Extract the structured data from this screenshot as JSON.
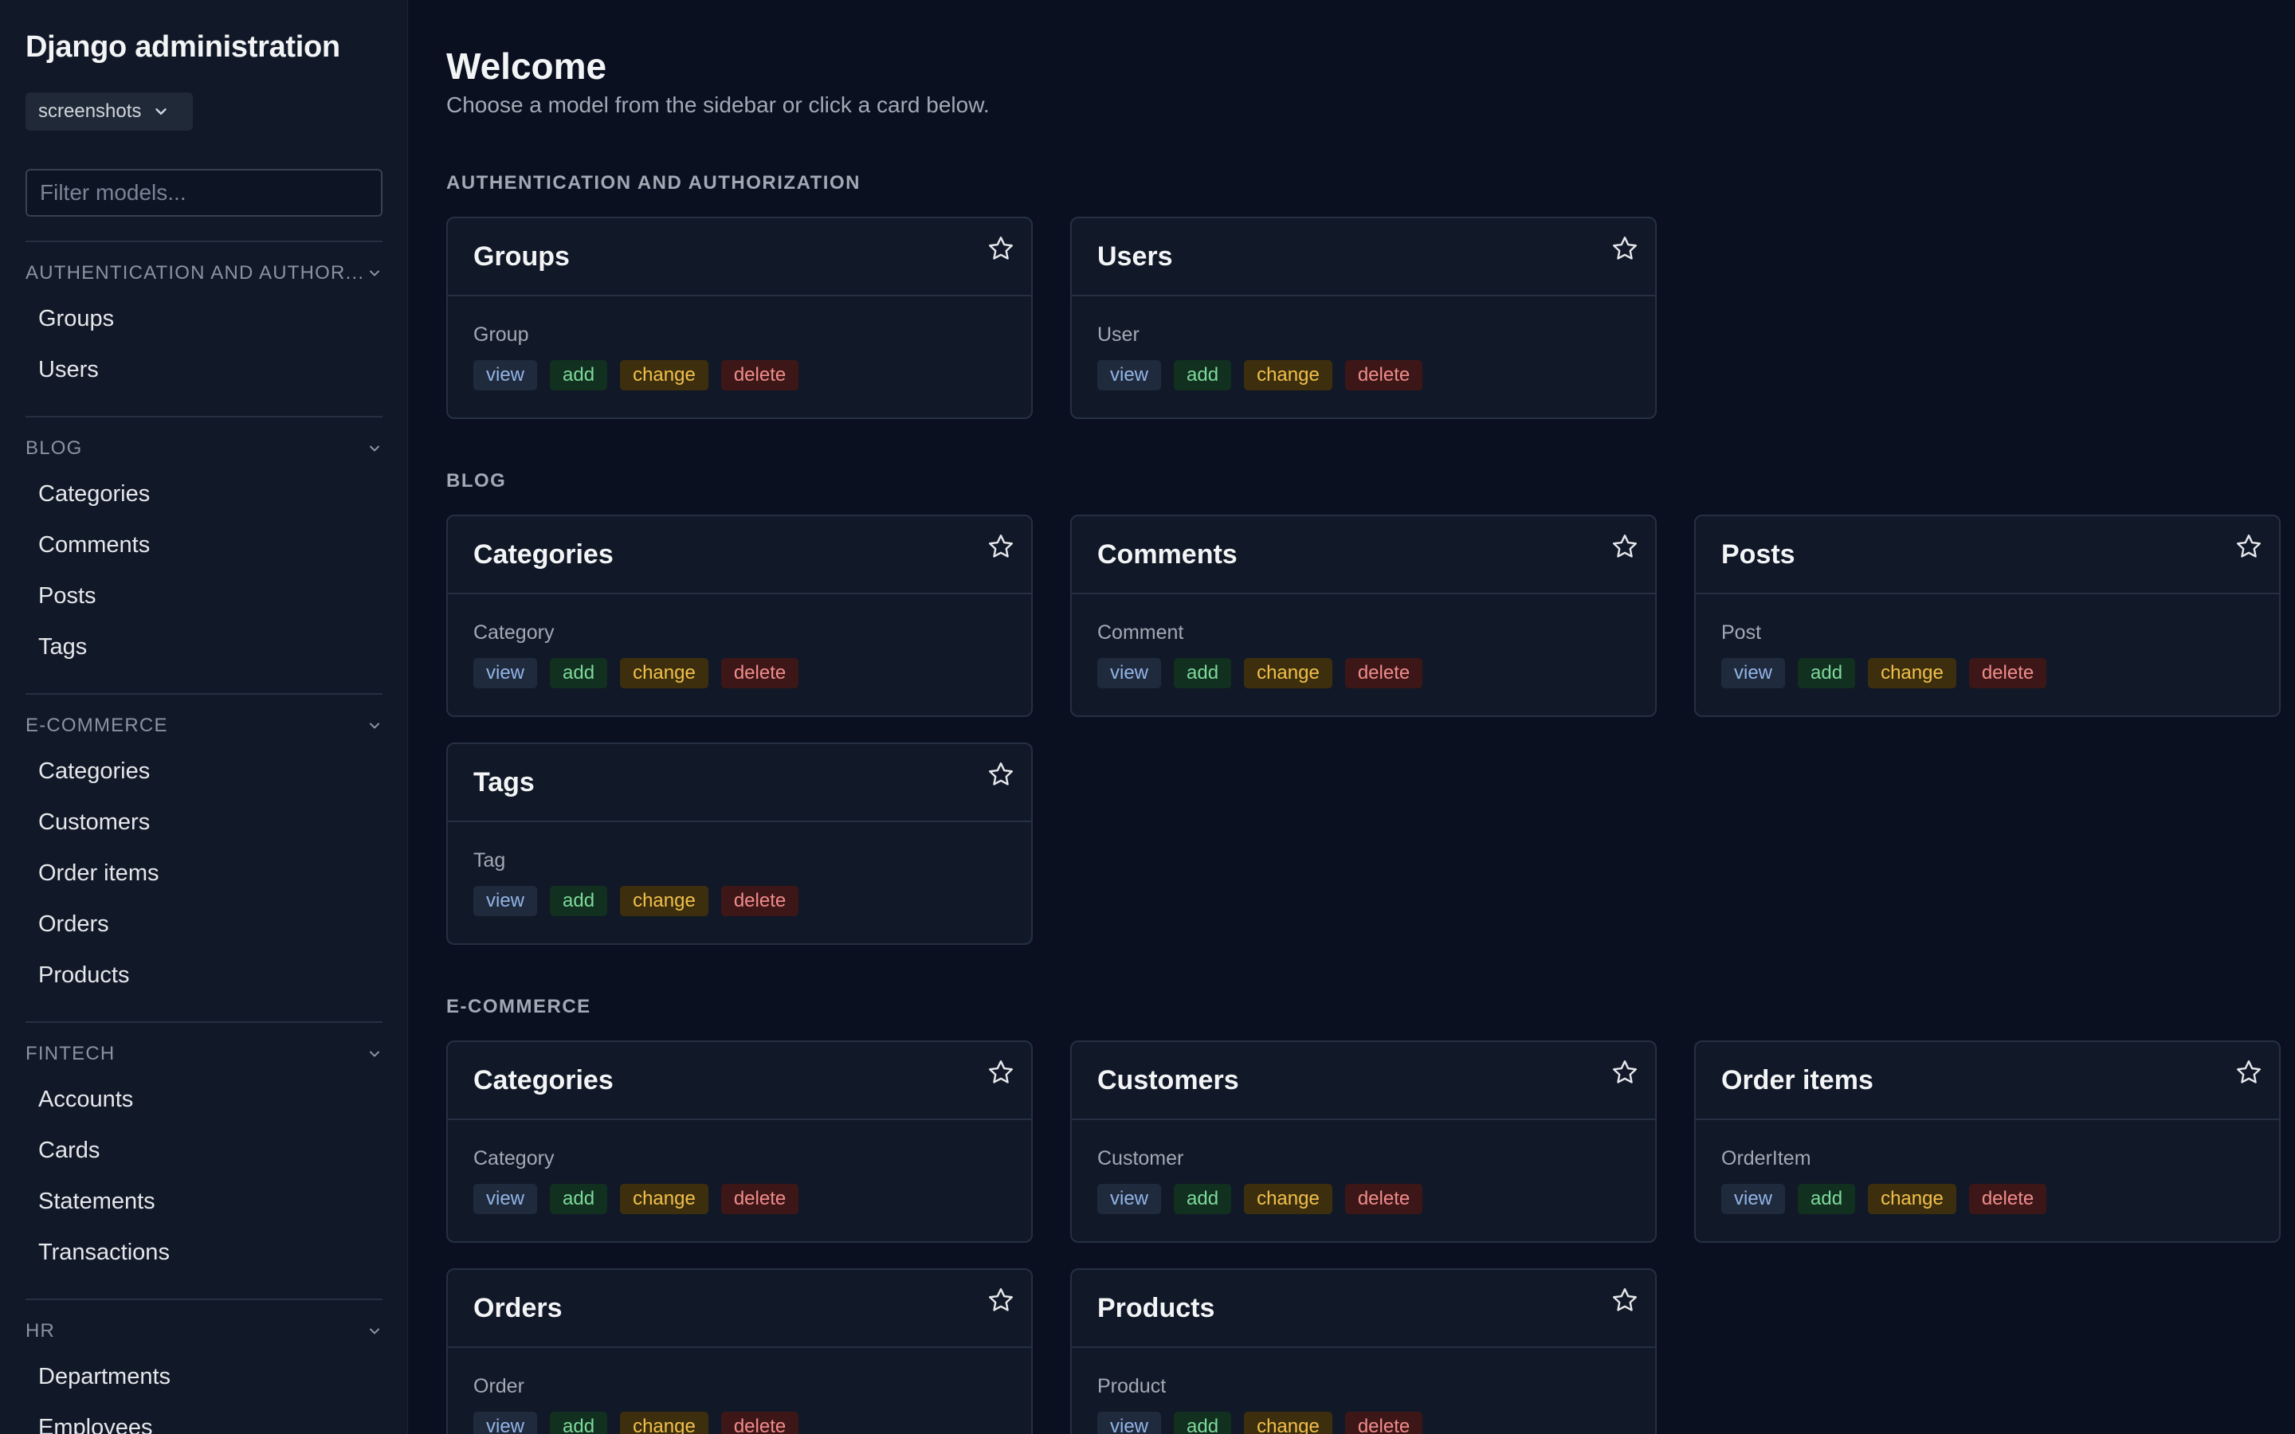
{
  "sidebar": {
    "brand": "Django administration",
    "db_select": "screenshots",
    "filter_placeholder": "Filter models...",
    "groups": [
      {
        "label": "AUTHENTICATION AND AUTHOR...",
        "items": [
          "Groups",
          "Users"
        ]
      },
      {
        "label": "BLOG",
        "items": [
          "Categories",
          "Comments",
          "Posts",
          "Tags"
        ]
      },
      {
        "label": "E-COMMERCE",
        "items": [
          "Categories",
          "Customers",
          "Order items",
          "Orders",
          "Products"
        ]
      },
      {
        "label": "FINTECH",
        "items": [
          "Accounts",
          "Cards",
          "Statements",
          "Transactions"
        ]
      },
      {
        "label": "HR",
        "items": [
          "Departments",
          "Employees"
        ]
      }
    ]
  },
  "main": {
    "title": "Welcome",
    "subtitle": "Choose a model from the sidebar or click a card below.",
    "permissions": {
      "view": "view",
      "add": "add",
      "change": "change",
      "delete": "delete"
    },
    "sections": [
      {
        "label": "AUTHENTICATION AND AUTHORIZATION",
        "cards": [
          {
            "title": "Groups",
            "model": "Group"
          },
          {
            "title": "Users",
            "model": "User"
          }
        ]
      },
      {
        "label": "BLOG",
        "cards": [
          {
            "title": "Categories",
            "model": "Category"
          },
          {
            "title": "Comments",
            "model": "Comment"
          },
          {
            "title": "Posts",
            "model": "Post"
          },
          {
            "title": "Tags",
            "model": "Tag"
          }
        ]
      },
      {
        "label": "E-COMMERCE",
        "cards": [
          {
            "title": "Categories",
            "model": "Category"
          },
          {
            "title": "Customers",
            "model": "Customer"
          },
          {
            "title": "Order items",
            "model": "OrderItem"
          },
          {
            "title": "Orders",
            "model": "Order"
          },
          {
            "title": "Products",
            "model": "Product"
          }
        ]
      }
    ]
  },
  "icons": {
    "star": "star-outline-icon",
    "chevron": "chevron-down-icon"
  },
  "colors": {
    "background": "#0a1020",
    "sidebar": "#111827",
    "card": "#111827",
    "border": "#263042",
    "perm_view": "#93b4e6",
    "perm_add": "#7ed99b",
    "perm_change": "#f2c04b",
    "perm_delete": "#f18b8b"
  }
}
